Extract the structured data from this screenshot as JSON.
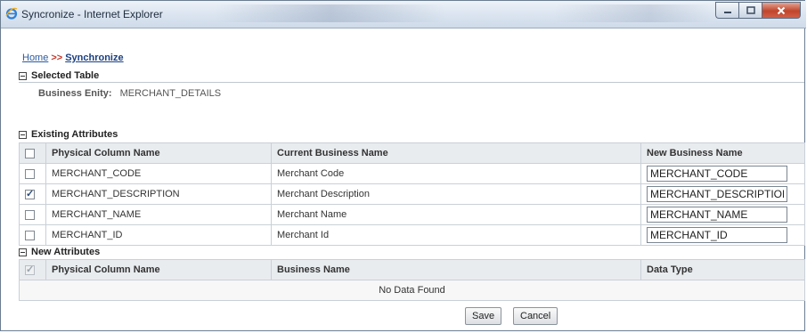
{
  "window": {
    "title": "Syncronize - Internet Explorer",
    "icon": "ie-icon",
    "controls": [
      "minimize-icon",
      "maximize-icon",
      "close-icon"
    ]
  },
  "breadcrumb": {
    "home": "Home",
    "separator": ">>",
    "current": "Synchronize"
  },
  "selected_table": {
    "heading": "Selected Table",
    "entity_label": "Business Enity:",
    "entity_value": "MERCHANT_DETAILS"
  },
  "existing_attributes": {
    "heading": "Existing Attributes",
    "columns": [
      "Physical Column Name",
      "Current Business Name",
      "New Business Name"
    ],
    "rows": [
      {
        "checked": false,
        "physical": "MERCHANT_CODE",
        "current": "Merchant Code",
        "new": "MERCHANT_CODE"
      },
      {
        "checked": true,
        "physical": "MERCHANT_DESCRIPTION",
        "current": "Merchant Description",
        "new": "MERCHANT_DESCRIPTION"
      },
      {
        "checked": false,
        "physical": "MERCHANT_NAME",
        "current": "Merchant Name",
        "new": "MERCHANT_NAME"
      },
      {
        "checked": false,
        "physical": "MERCHANT_ID",
        "current": "Merchant Id",
        "new": "MERCHANT_ID"
      }
    ]
  },
  "new_attributes": {
    "heading": "New Attributes",
    "columns": [
      "Physical Column Name",
      "Business Name",
      "Data Type"
    ],
    "empty_text": "No Data Found"
  },
  "actions": {
    "save_label": "Save",
    "cancel_label": "Cancel"
  },
  "colors": {
    "link": "#2b5aa0",
    "separator": "#c0392b",
    "header_bg": "#e9ecef",
    "close_button": "#c1452b"
  }
}
